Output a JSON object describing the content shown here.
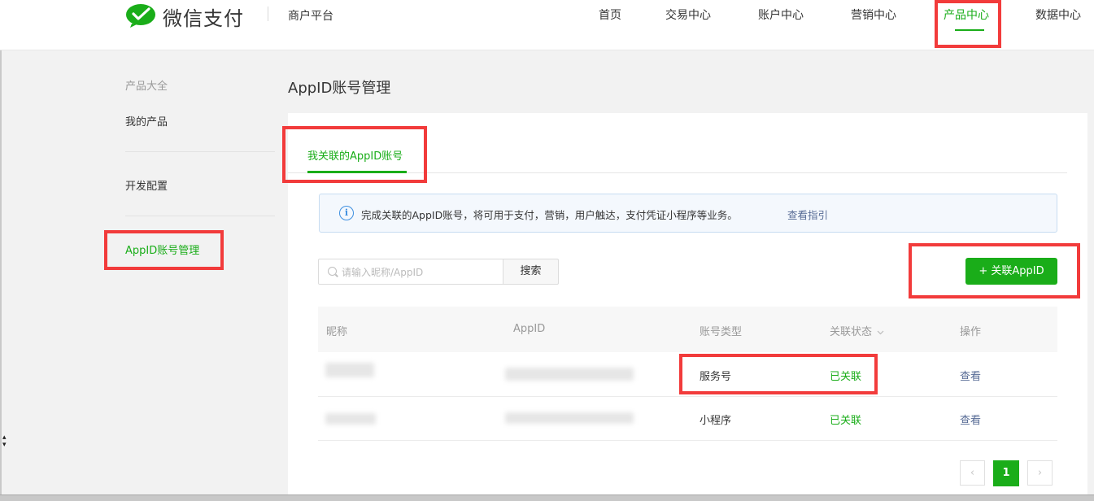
{
  "brand": {
    "logo_icon": "wechat-pay-logo-icon",
    "name": "微信支付",
    "platform": "商户平台",
    "color": "#1aad19"
  },
  "nav": {
    "items": [
      {
        "label": "首页"
      },
      {
        "label": "交易中心"
      },
      {
        "label": "账户中心"
      },
      {
        "label": "营销中心"
      },
      {
        "label": "产品中心",
        "active": true
      },
      {
        "label": "数据中心"
      }
    ]
  },
  "sidebar": {
    "group_title": "产品大全",
    "items": [
      {
        "label": "我的产品"
      },
      {
        "label": "开发配置"
      },
      {
        "label": "AppID账号管理",
        "active": true
      }
    ]
  },
  "page": {
    "title": "AppID账号管理",
    "tab": "我关联的AppID账号",
    "notice": {
      "icon": "info-icon",
      "text": "完成关联的AppID账号，将可用于支付，营销，用户触达，支付凭证小程序等业务。",
      "link": "查看指引"
    },
    "search": {
      "placeholder": "请输入昵称/AppID",
      "value": "",
      "button": "搜索"
    },
    "add_button": "+ 关联AppID"
  },
  "table": {
    "columns": [
      "昵称",
      "AppID",
      "账号类型",
      "关联状态",
      "操作"
    ],
    "sort_icon": "chevron-down-icon",
    "rows": [
      {
        "nickname": "",
        "appid": "",
        "type": "服务号",
        "status": "已关联",
        "action": "查看"
      },
      {
        "nickname": "",
        "appid": "",
        "type": "小程序",
        "status": "已关联",
        "action": "查看"
      }
    ]
  },
  "pagination": {
    "prev": "‹",
    "current": "1",
    "next": "›"
  },
  "colors": {
    "accent": "#1aad19",
    "link": "#576b95",
    "highlight": "#f23b3b",
    "info": "#3e8fe0"
  }
}
